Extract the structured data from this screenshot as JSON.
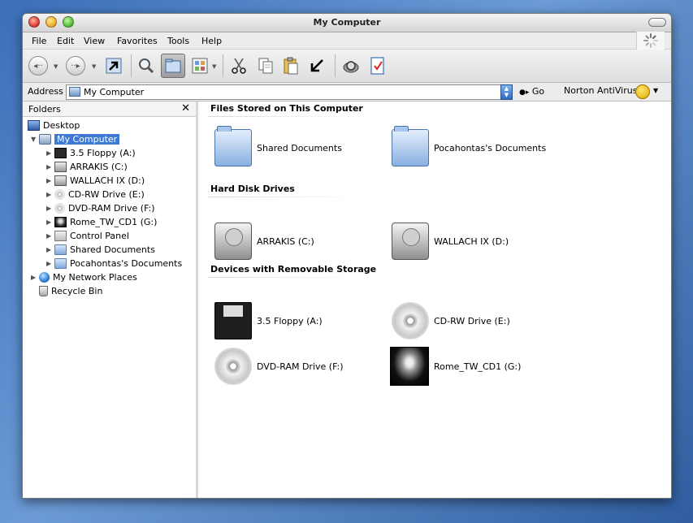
{
  "window": {
    "title": "My Computer"
  },
  "menu": [
    "File",
    "Edit",
    "View",
    "Favorites",
    "Tools",
    "Help"
  ],
  "address": {
    "label": "Address",
    "value": "My Computer",
    "go_label": "Go",
    "plugin_label": "Norton AntiVirus"
  },
  "sidebar": {
    "title": "Folders",
    "close": "✕",
    "items": [
      {
        "label": "Desktop"
      },
      {
        "label": "My Computer"
      },
      {
        "label": "3.5 Floppy (A:)"
      },
      {
        "label": "ARRAKIS (C:)"
      },
      {
        "label": "WALLACH IX (D:)"
      },
      {
        "label": "CD-RW Drive (E:)"
      },
      {
        "label": "DVD-RAM Drive (F:)"
      },
      {
        "label": "Rome_TW_CD1 (G:)"
      },
      {
        "label": "Control Panel"
      },
      {
        "label": "Shared Documents"
      },
      {
        "label": "Pocahontas's Documents"
      },
      {
        "label": "My Network Places"
      },
      {
        "label": "Recycle Bin"
      }
    ]
  },
  "groups": [
    {
      "title": "Files Stored on This Computer",
      "items": [
        {
          "label": "Shared Documents",
          "icon": "folder-icon"
        },
        {
          "label": "Pocahontas's Documents",
          "icon": "folder-icon"
        }
      ]
    },
    {
      "title": "Hard Disk Drives",
      "items": [
        {
          "label": "ARRAKIS (C:)",
          "icon": "hard-drive-icon"
        },
        {
          "label": "WALLACH IX (D:)",
          "icon": "hard-drive-icon"
        }
      ]
    },
    {
      "title": "Devices with Removable Storage",
      "items": [
        {
          "label": "3.5 Floppy (A:)",
          "icon": "floppy-icon"
        },
        {
          "label": "CD-RW Drive (E:)",
          "icon": "cd-icon"
        },
        {
          "label": "DVD-RAM Drive (F:)",
          "icon": "cd-icon"
        },
        {
          "label": "Rome_TW_CD1 (G:)",
          "icon": "disc-photo-icon"
        }
      ]
    }
  ],
  "colors": {
    "selection": "#3e7ad4",
    "desktop_blue": "#3a6fb8"
  }
}
